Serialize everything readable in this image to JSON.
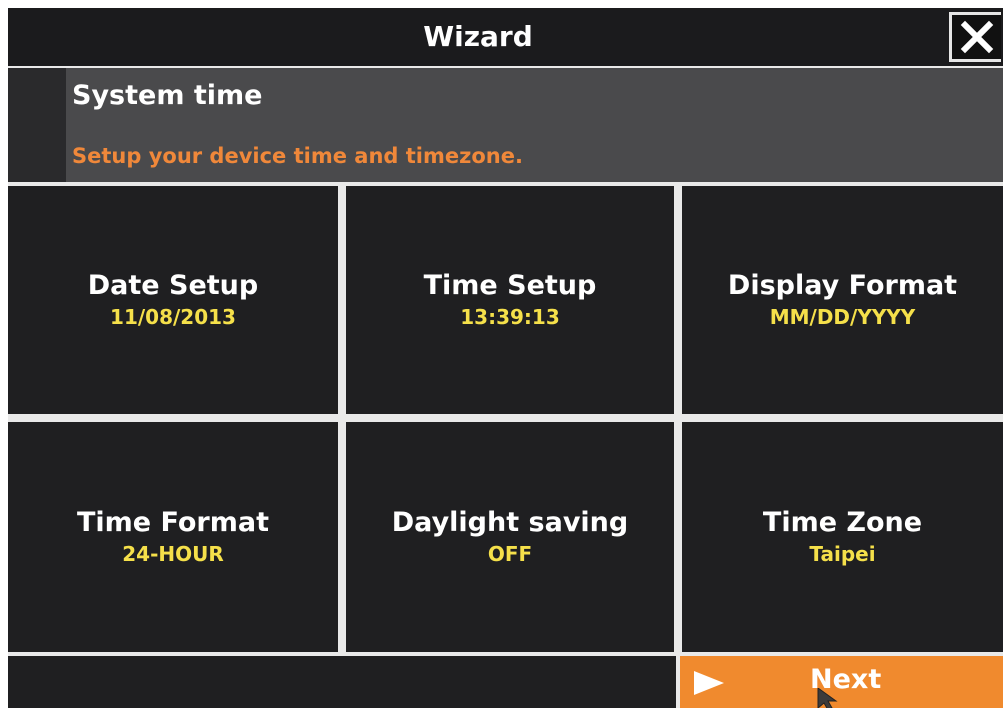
{
  "window": {
    "title": "Wizard",
    "close_icon": "close-icon"
  },
  "header": {
    "title": "System time",
    "subtitle": "Setup your device time and timezone."
  },
  "tiles": [
    {
      "label": "Date Setup",
      "value": "11/08/2013"
    },
    {
      "label": "Time Setup",
      "value": "13:39:13"
    },
    {
      "label": "Display Format",
      "value": "MM/DD/YYYY"
    },
    {
      "label": "Time Format",
      "value": "24-HOUR"
    },
    {
      "label": "Daylight saving",
      "value": "OFF"
    },
    {
      "label": "Time Zone",
      "value": "Taipei"
    }
  ],
  "footer": {
    "next_label": "Next",
    "next_icon": "play-arrow-icon"
  },
  "colors": {
    "accent": "#f08a2e",
    "subtitle": "#f0883a",
    "value": "#f5e04a",
    "tile_bg": "#1f1f21",
    "header_bg": "#4a4a4c"
  }
}
